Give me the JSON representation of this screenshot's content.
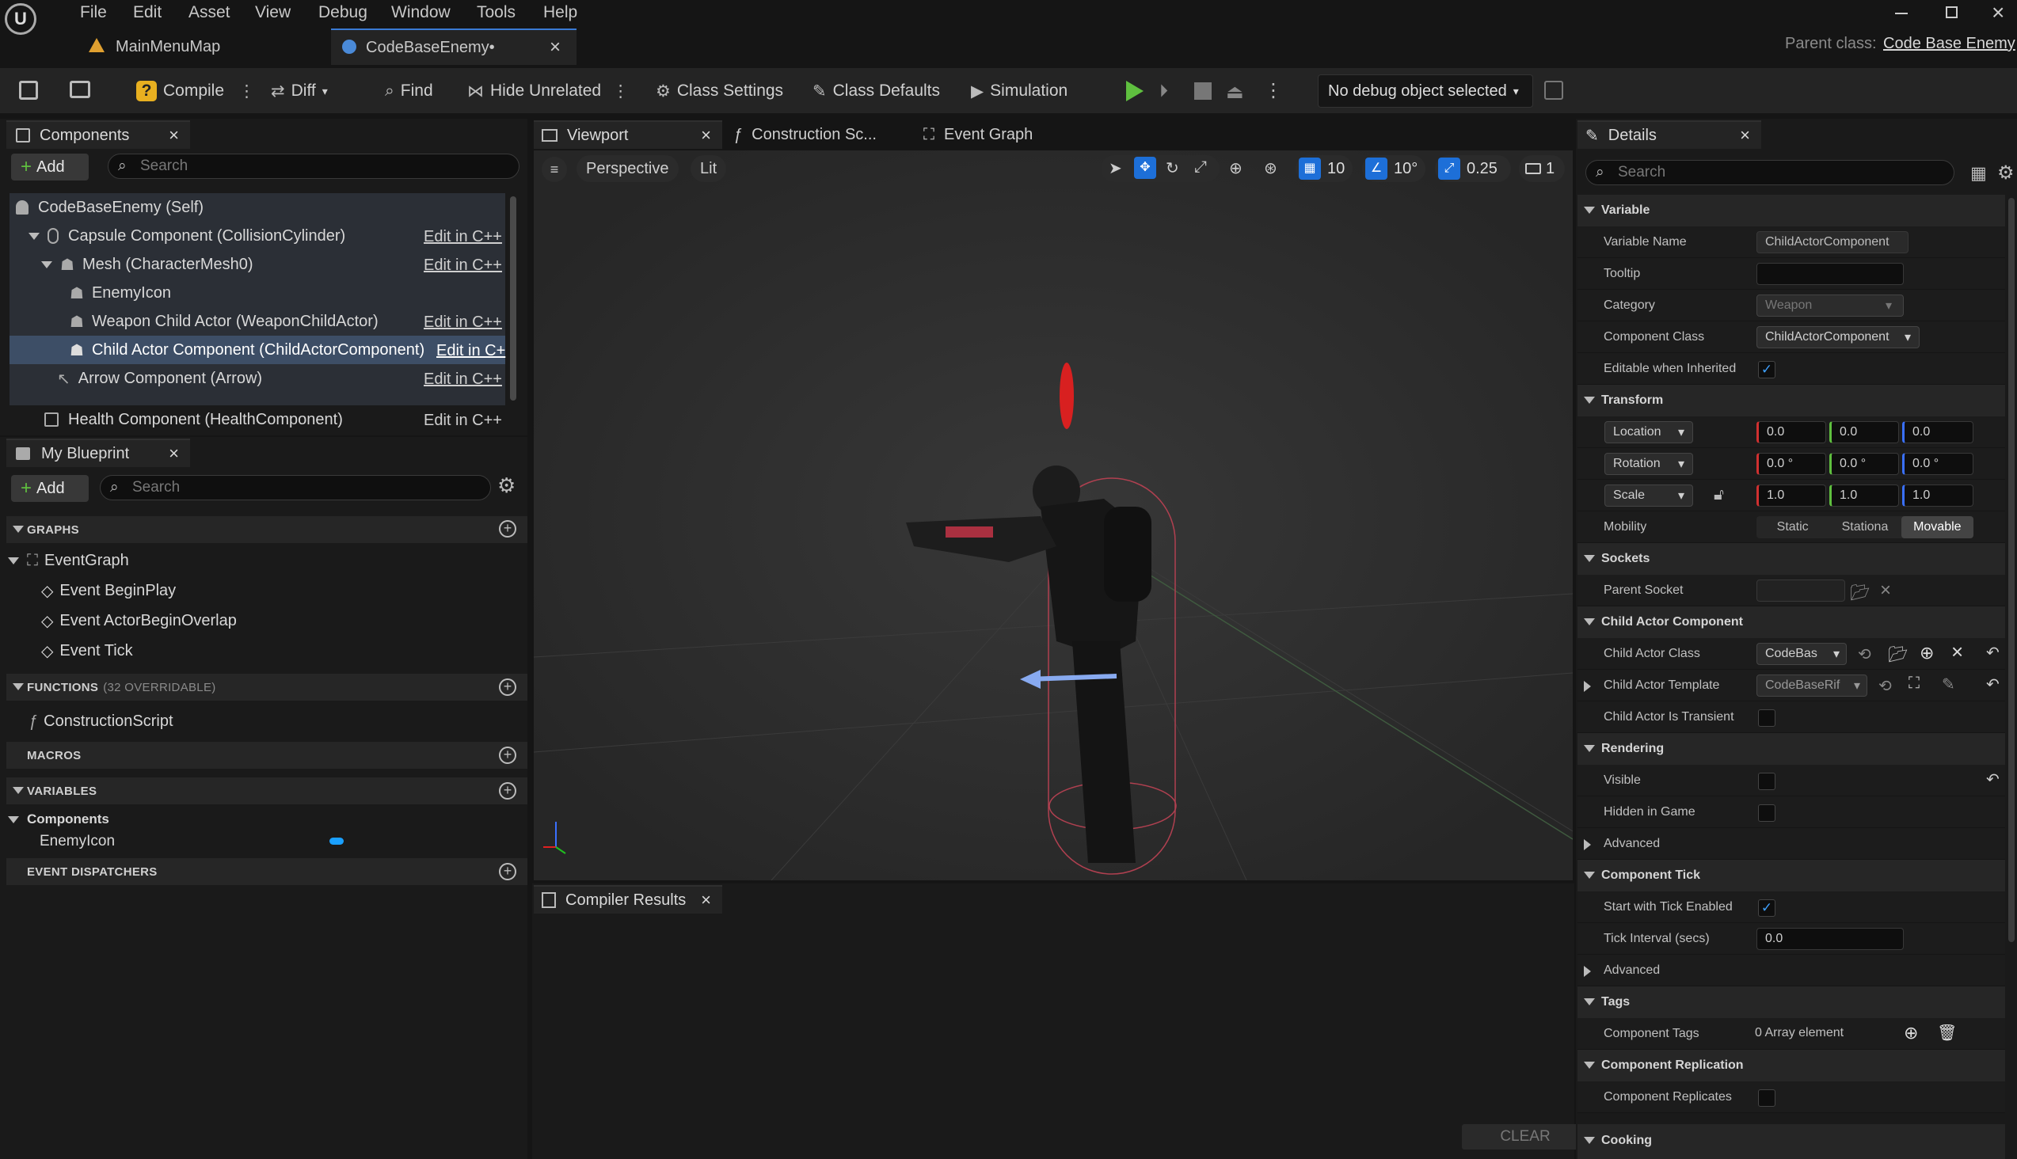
{
  "menu": [
    "File",
    "Edit",
    "Asset",
    "View",
    "Debug",
    "Window",
    "Tools",
    "Help"
  ],
  "tabs": [
    {
      "label": "MainMenuMap"
    },
    {
      "label": "CodeBaseEnemy•"
    }
  ],
  "parent_class": {
    "label": "Parent class:",
    "value": "Code Base Enemy"
  },
  "toolbar": {
    "compile": "Compile",
    "diff": "Diff",
    "find": "Find",
    "hide_unrelated": "Hide Unrelated",
    "class_settings": "Class Settings",
    "class_defaults": "Class Defaults",
    "simulation": "Simulation",
    "debug_object": "No debug object selected"
  },
  "components": {
    "title": "Components",
    "add": "Add",
    "search_placeholder": "Search",
    "edit_cpp": "Edit in C++",
    "edit_cpp_cut": "Edit in C+",
    "items": [
      {
        "label": "CodeBaseEnemy (Self)"
      },
      {
        "label": "Capsule Component (CollisionCylinder)"
      },
      {
        "label": "Mesh (CharacterMesh0)"
      },
      {
        "label": "EnemyIcon"
      },
      {
        "label": "Weapon Child Actor (WeaponChildActor)"
      },
      {
        "label": "Child Actor Component (ChildActorComponent)"
      },
      {
        "label": "Arrow Component (Arrow)"
      },
      {
        "label": "Health Component (HealthComponent)"
      }
    ]
  },
  "my_blueprint": {
    "title": "My Blueprint",
    "add": "Add",
    "search_placeholder": "Search",
    "graphs": "GRAPHS",
    "event_graph": "EventGraph",
    "events": [
      "Event BeginPlay",
      "Event ActorBeginOverlap",
      "Event Tick"
    ],
    "functions": "FUNCTIONS",
    "functions_note": "(32 OVERRIDABLE)",
    "construction_script": "ConstructionScript",
    "macros": "MACROS",
    "variables": "VARIABLES",
    "components_cat": "Components",
    "enemy_icon": "EnemyIcon",
    "event_dispatchers": "EVENT DISPATCHERS"
  },
  "center_tabs": [
    "Viewport",
    "Construction Sc...",
    "Event Graph"
  ],
  "viewport": {
    "perspective": "Perspective",
    "lit": "Lit",
    "grid": "10",
    "angle": "10°",
    "scale": "0.25",
    "camera": "1"
  },
  "compiler": {
    "title": "Compiler Results",
    "clear": "CLEAR"
  },
  "details": {
    "title": "Details",
    "search_placeholder": "Search",
    "variable": "Variable",
    "variable_name_label": "Variable Name",
    "variable_name": "ChildActorComponent",
    "tooltip_label": "Tooltip",
    "category_label": "Category",
    "category": "Weapon",
    "component_class_label": "Component Class",
    "component_class": "ChildActorComponent",
    "editable_label": "Editable when Inherited",
    "transform": "Transform",
    "location": "Location",
    "rotation": "Rotation",
    "scale": "Scale",
    "loc": [
      "0.0",
      "0.0",
      "0.0"
    ],
    "rot": [
      "0.0 °",
      "0.0 °",
      "0.0 °"
    ],
    "scl": [
      "1.0",
      "1.0",
      "1.0"
    ],
    "mobility_label": "Mobility",
    "mobility": [
      "Static",
      "Stationa",
      "Movable"
    ],
    "sockets": "Sockets",
    "parent_socket": "Parent Socket",
    "child_actor_component": "Child Actor Component",
    "child_actor_class_label": "Child Actor Class",
    "child_actor_class": "CodeBas",
    "child_actor_template_label": "Child Actor Template",
    "child_actor_template": "CodeBaseRif",
    "transient_label": "Child Actor Is Transient",
    "rendering": "Rendering",
    "visible_label": "Visible",
    "hidden_label": "Hidden in Game",
    "advanced": "Advanced",
    "component_tick": "Component Tick",
    "tick_enabled_label": "Start with Tick Enabled",
    "tick_interval_label": "Tick Interval (secs)",
    "tick_interval": "0.0",
    "tags": "Tags",
    "component_tags_label": "Component Tags",
    "component_tags": "0 Array element",
    "replication": "Component Replication",
    "replicates_label": "Component Replicates",
    "cooking": "Cooking"
  }
}
